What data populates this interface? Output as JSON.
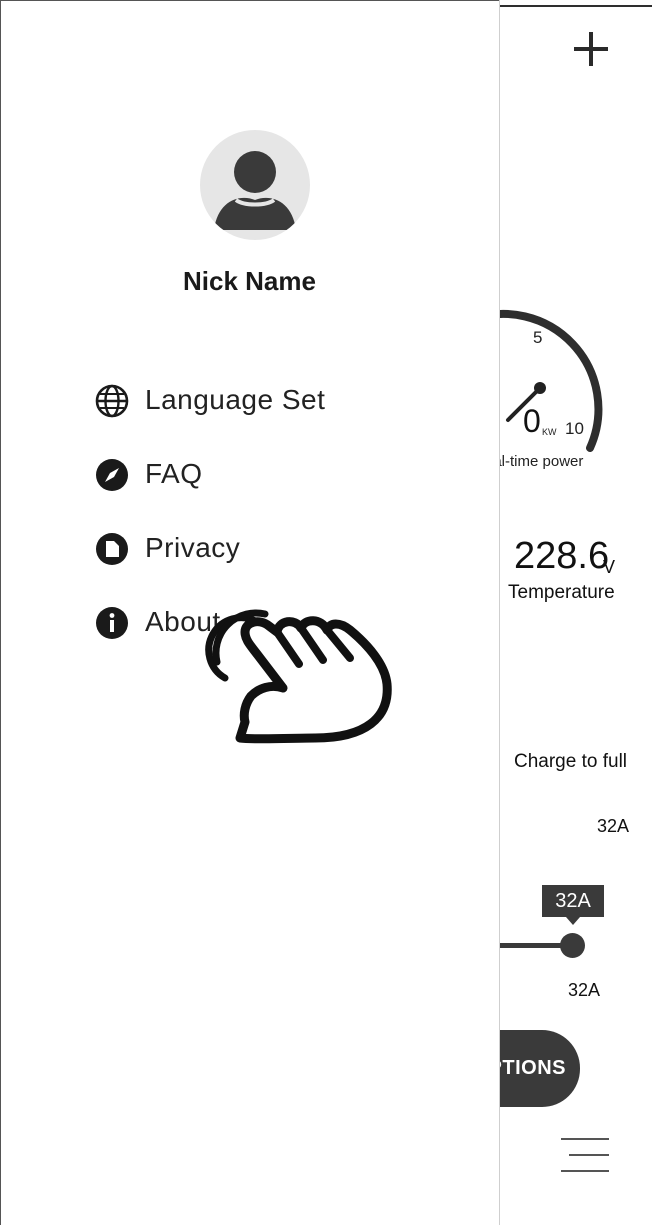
{
  "dashboard": {
    "gauge": {
      "max_tick": "10",
      "mid_tick": "5",
      "value": "0",
      "unit": "KW",
      "label": "eal-time power"
    },
    "voltage": {
      "value": "228.6",
      "unit": "V",
      "label": "Temperature"
    },
    "charge_mode": "Charge to full",
    "current_top": "32A",
    "slider": {
      "tooltip": "32A",
      "value_label": "32A",
      "level_fraction": 1.0
    },
    "options_button": "PTIONS"
  },
  "drawer": {
    "user": {
      "nick_name": "Nick Name"
    },
    "menu": [
      {
        "label": "Language Set",
        "icon": "globe-icon"
      },
      {
        "label": "FAQ",
        "icon": "compass-icon"
      },
      {
        "label": "Privacy",
        "icon": "document-icon"
      },
      {
        "label": "About",
        "icon": "info-icon"
      }
    ]
  },
  "colors": {
    "dark": "#3a3a3a",
    "text": "#222222",
    "avatar_bg": "#e6e6e6"
  }
}
